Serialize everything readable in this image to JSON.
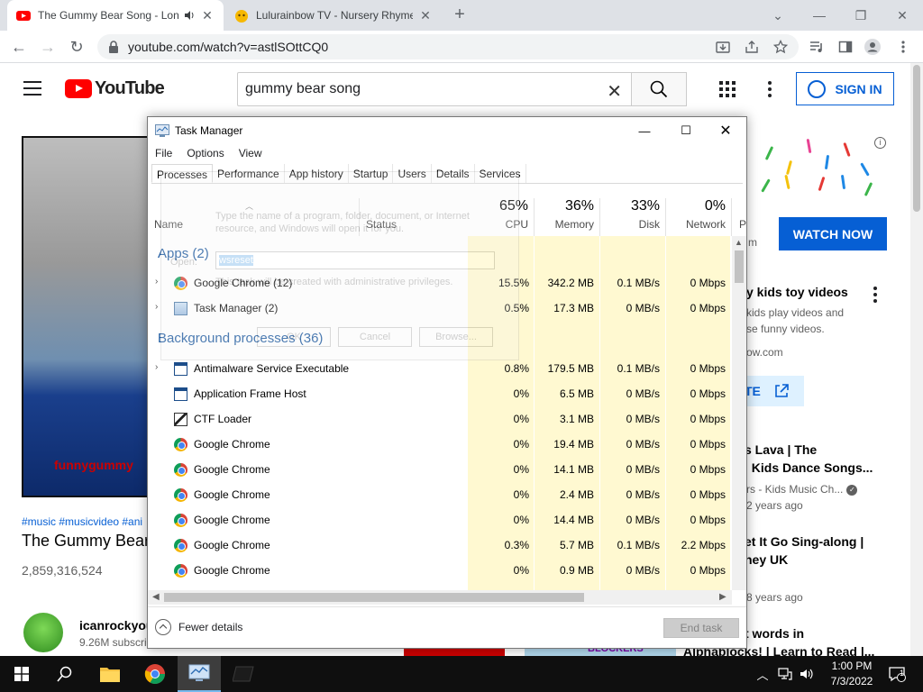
{
  "browser": {
    "tabs": [
      {
        "title": "The Gummy Bear Song - Lon",
        "active": true
      },
      {
        "title": "Lulurainbow TV - Nursery Rhyme",
        "active": false
      }
    ],
    "url": "youtube.com/watch?v=astlSOttCQ0"
  },
  "youtube": {
    "logo": "YouTube",
    "search_query": "gummy bear song",
    "sign_in": "SIGN IN",
    "video": {
      "watermark": "funnygummy",
      "hashtags": "#music #musicvideo #ani",
      "title": "The Gummy Bear",
      "views": "2,859,316,524",
      "channel": "icanrockyou",
      "subscribers": "9.26M subscri"
    },
    "sidebar": {
      "watch_now": "WATCH NOW",
      "ad_title": "y kids toy videos",
      "ad_line1": "kids play videos and",
      "ad_line2": "se funny videos.",
      "ad_domain": "ow.com",
      "ad_m": "m",
      "visit": "TE",
      "rec1_line1": "s Lava | The",
      "rec1_line2": "| Kids Dance Songs...",
      "rec1_channel": "rs - Kids Music Ch...",
      "rec1_age": "2 years ago",
      "rec2_line1": "et It Go Sing-along |",
      "rec2_line2": "ney UK",
      "rec2_age": "8 years ago",
      "rec3_line1": "t words in",
      "rec3_line2": "Alphablocks! | Learn to Read |...",
      "bottom_thumb_text": "BLOCKERS"
    }
  },
  "task_manager": {
    "title": "Task Manager",
    "menu": [
      "File",
      "Options",
      "View"
    ],
    "tabs": [
      "Processes",
      "Performance",
      "App history",
      "Startup",
      "Users",
      "Details",
      "Services"
    ],
    "columns": {
      "name": "Name",
      "status": "Status",
      "p_col": "P",
      "cpu": {
        "pct": "65%",
        "label": "CPU"
      },
      "memory": {
        "pct": "36%",
        "label": "Memory"
      },
      "disk": {
        "pct": "33%",
        "label": "Disk"
      },
      "network": {
        "pct": "0%",
        "label": "Network"
      }
    },
    "groups": {
      "apps": "Apps (2)",
      "background": "Background processes (36)"
    },
    "apps": [
      {
        "name": "Google Chrome (12)",
        "icon": "chrome-icon",
        "cpu": "15.5%",
        "memory": "342.2 MB",
        "disk": "0.1 MB/s",
        "network": "0 Mbps"
      },
      {
        "name": "Task Manager (2)",
        "icon": "task-manager-icon",
        "cpu": "0.5%",
        "memory": "17.3 MB",
        "disk": "0 MB/s",
        "network": "0 Mbps"
      }
    ],
    "background": [
      {
        "name": "Antimalware Service Executable",
        "icon": "service-icon",
        "expandable": true,
        "cpu": "0.8%",
        "memory": "179.5 MB",
        "disk": "0.1 MB/s",
        "network": "0 Mbps"
      },
      {
        "name": "Application Frame Host",
        "icon": "service-icon",
        "cpu": "0%",
        "memory": "6.5 MB",
        "disk": "0 MB/s",
        "network": "0 Mbps"
      },
      {
        "name": "CTF Loader",
        "icon": "ctf-icon",
        "cpu": "0%",
        "memory": "3.1 MB",
        "disk": "0 MB/s",
        "network": "0 Mbps"
      },
      {
        "name": "Google Chrome",
        "icon": "chrome-icon",
        "cpu": "0%",
        "memory": "19.4 MB",
        "disk": "0 MB/s",
        "network": "0 Mbps"
      },
      {
        "name": "Google Chrome",
        "icon": "chrome-icon",
        "cpu": "0%",
        "memory": "14.1 MB",
        "disk": "0 MB/s",
        "network": "0 Mbps"
      },
      {
        "name": "Google Chrome",
        "icon": "chrome-icon",
        "cpu": "0%",
        "memory": "2.4 MB",
        "disk": "0 MB/s",
        "network": "0 Mbps"
      },
      {
        "name": "Google Chrome",
        "icon": "chrome-icon",
        "cpu": "0%",
        "memory": "14.4 MB",
        "disk": "0 MB/s",
        "network": "0 Mbps"
      },
      {
        "name": "Google Chrome",
        "icon": "chrome-icon",
        "cpu": "0.3%",
        "memory": "5.7 MB",
        "disk": "0.1 MB/s",
        "network": "2.2 Mbps"
      },
      {
        "name": "Google Chrome",
        "icon": "chrome-icon",
        "cpu": "0%",
        "memory": "0.9 MB",
        "disk": "0 MB/s",
        "network": "0 Mbps"
      }
    ],
    "fewer_details": "Fewer details",
    "end_task": "End task",
    "ghost_run_dialog": {
      "description": "Type the name of a program, folder, document, or Internet resource, and Windows will open it for you.",
      "open_label": "Open:",
      "open_value": "wsreset",
      "admin_note": "This task will be created with administrative privileges.",
      "ok": "OK",
      "cancel": "Cancel",
      "browse": "Browse..."
    }
  },
  "taskbar": {
    "time": "1:00 PM",
    "date": "7/3/2022",
    "notification_count": "1"
  }
}
